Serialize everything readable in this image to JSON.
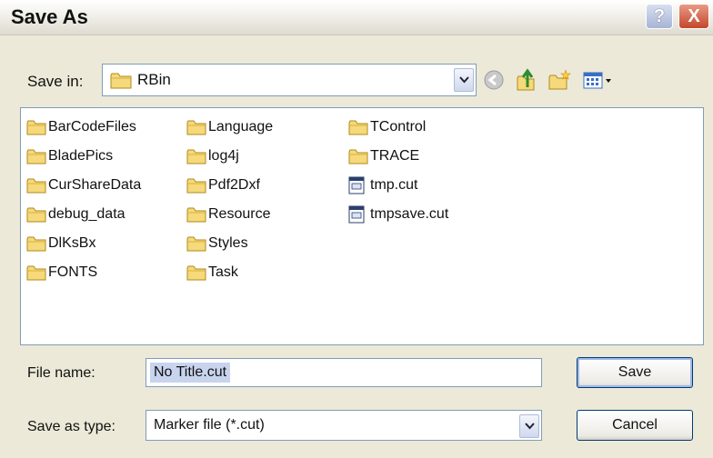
{
  "window": {
    "title": "Save As",
    "help_label": "?",
    "close_label": "X"
  },
  "location": {
    "label": "Save in:",
    "value": "RBin"
  },
  "files": [
    {
      "name": "BarCodeFiles",
      "kind": "folder"
    },
    {
      "name": "BladePics",
      "kind": "folder"
    },
    {
      "name": "CurShareData",
      "kind": "folder"
    },
    {
      "name": "debug_data",
      "kind": "folder"
    },
    {
      "name": "DlKsBx",
      "kind": "folder"
    },
    {
      "name": "FONTS",
      "kind": "folder"
    },
    {
      "name": "Language",
      "kind": "folder"
    },
    {
      "name": "log4j",
      "kind": "folder"
    },
    {
      "name": "Pdf2Dxf",
      "kind": "folder"
    },
    {
      "name": "Resource",
      "kind": "folder"
    },
    {
      "name": "Styles",
      "kind": "folder"
    },
    {
      "name": "Task",
      "kind": "folder"
    },
    {
      "name": "TControl",
      "kind": "folder"
    },
    {
      "name": "TRACE",
      "kind": "folder"
    },
    {
      "name": "tmp.cut",
      "kind": "file"
    },
    {
      "name": "tmpsave.cut",
      "kind": "file"
    }
  ],
  "file_name": {
    "label": "File name:",
    "value": "No Title.cut"
  },
  "file_type": {
    "label": "Save as type:",
    "value": "Marker file (*.cut)"
  },
  "buttons": {
    "save": "Save",
    "cancel": "Cancel"
  },
  "colors": {
    "folder": "#f5d97a",
    "selection": "#c8d4ee",
    "close": "#c4462b",
    "border": "#7f9db9"
  },
  "toolbar_icons": [
    "back-icon",
    "up-folder-icon",
    "new-folder-icon",
    "view-menu-icon"
  ]
}
